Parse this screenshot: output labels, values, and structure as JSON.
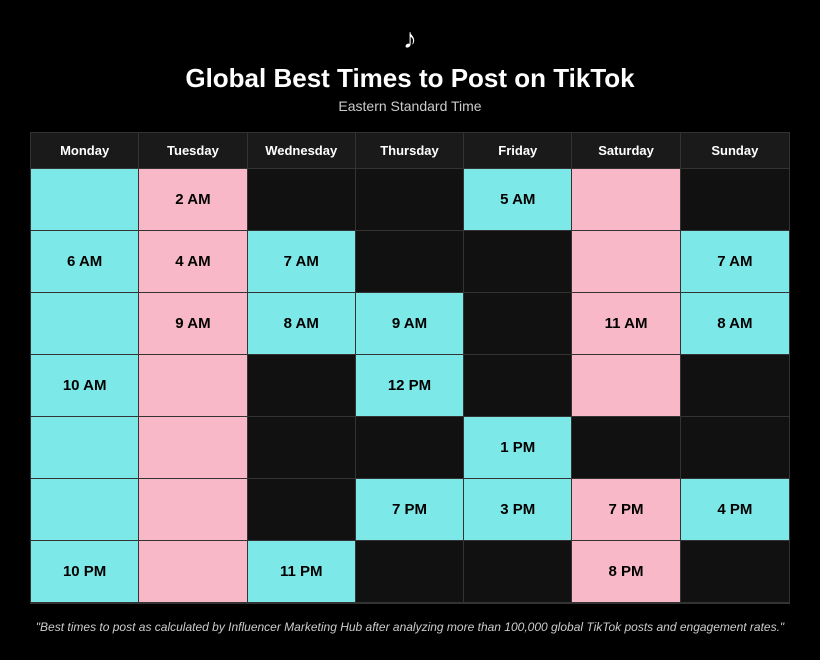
{
  "header": {
    "logo": "♪",
    "title": "Global Best Times to Post on TikTok",
    "subtitle": "Eastern Standard Time"
  },
  "columns": [
    "Monday",
    "Tuesday",
    "Wednesday",
    "Thursday",
    "Friday",
    "Saturday",
    "Sunday"
  ],
  "rows": [
    [
      {
        "text": "",
        "type": "empty-cyan"
      },
      {
        "text": "2 AM",
        "type": "pink"
      },
      {
        "text": "",
        "type": "empty-dark"
      },
      {
        "text": "",
        "type": "empty-dark"
      },
      {
        "text": "5 AM",
        "type": "cyan"
      },
      {
        "text": "",
        "type": "empty-pink"
      },
      {
        "text": "",
        "type": "empty-dark"
      }
    ],
    [
      {
        "text": "6 AM",
        "type": "cyan"
      },
      {
        "text": "4 AM",
        "type": "pink"
      },
      {
        "text": "7 AM",
        "type": "cyan"
      },
      {
        "text": "",
        "type": "empty-dark"
      },
      {
        "text": "",
        "type": "empty-dark"
      },
      {
        "text": "",
        "type": "empty-pink"
      },
      {
        "text": "7 AM",
        "type": "cyan"
      }
    ],
    [
      {
        "text": "",
        "type": "empty-cyan"
      },
      {
        "text": "9 AM",
        "type": "pink"
      },
      {
        "text": "8 AM",
        "type": "cyan"
      },
      {
        "text": "9 AM",
        "type": "cyan"
      },
      {
        "text": "",
        "type": "empty-dark"
      },
      {
        "text": "11 AM",
        "type": "pink"
      },
      {
        "text": "8 AM",
        "type": "cyan"
      }
    ],
    [
      {
        "text": "10 AM",
        "type": "cyan"
      },
      {
        "text": "",
        "type": "empty-pink"
      },
      {
        "text": "",
        "type": "empty-dark"
      },
      {
        "text": "12 PM",
        "type": "cyan"
      },
      {
        "text": "",
        "type": "empty-dark"
      },
      {
        "text": "",
        "type": "empty-pink"
      },
      {
        "text": "",
        "type": "empty-dark"
      }
    ],
    [
      {
        "text": "",
        "type": "empty-cyan"
      },
      {
        "text": "",
        "type": "empty-pink"
      },
      {
        "text": "",
        "type": "empty-dark"
      },
      {
        "text": "",
        "type": "empty-dark"
      },
      {
        "text": "1 PM",
        "type": "cyan"
      },
      {
        "text": "",
        "type": "empty-dark"
      },
      {
        "text": "",
        "type": "empty-dark"
      }
    ],
    [
      {
        "text": "",
        "type": "empty-cyan"
      },
      {
        "text": "",
        "type": "empty-pink"
      },
      {
        "text": "",
        "type": "empty-dark"
      },
      {
        "text": "7 PM",
        "type": "cyan"
      },
      {
        "text": "3 PM",
        "type": "cyan"
      },
      {
        "text": "7 PM",
        "type": "pink"
      },
      {
        "text": "4 PM",
        "type": "cyan"
      }
    ],
    [
      {
        "text": "10 PM",
        "type": "cyan"
      },
      {
        "text": "",
        "type": "empty-pink"
      },
      {
        "text": "11 PM",
        "type": "cyan"
      },
      {
        "text": "",
        "type": "empty-dark"
      },
      {
        "text": "",
        "type": "empty-dark"
      },
      {
        "text": "8 PM",
        "type": "pink"
      },
      {
        "text": "",
        "type": "empty-dark"
      }
    ]
  ],
  "footer": "\"Best times to post as calculated by Influencer Marketing Hub after analyzing\nmore than 100,000 global TikTok posts and engagement rates.\""
}
